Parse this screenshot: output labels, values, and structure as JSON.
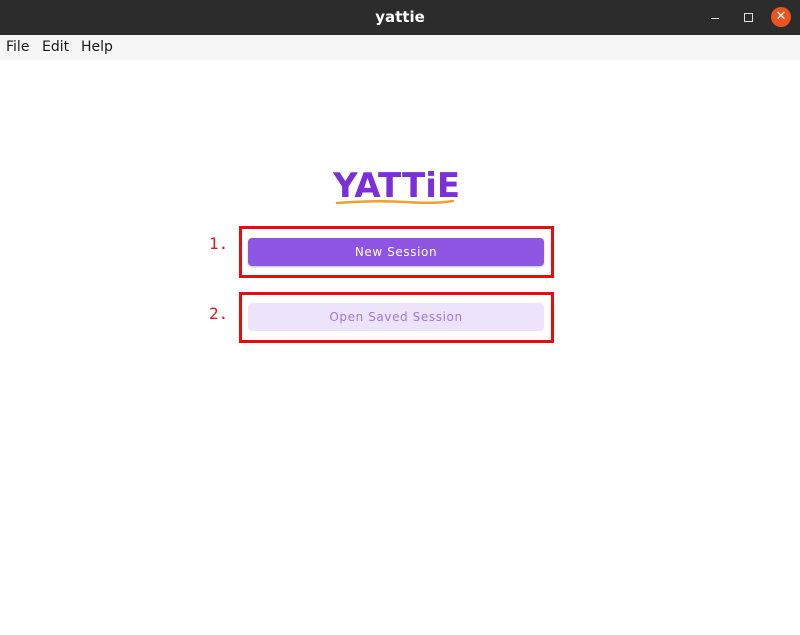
{
  "window": {
    "title": "yattie",
    "controls": {
      "minimize_icon": "minimize-icon",
      "maximize_icon": "maximize-icon",
      "close_glyph": "✕"
    }
  },
  "menubar": {
    "items": [
      {
        "label": "File"
      },
      {
        "label": "Edit"
      },
      {
        "label": "Help"
      }
    ]
  },
  "main": {
    "logo_text": "YATTiE",
    "annotations": [
      "1.",
      "2."
    ],
    "buttons": {
      "new_session": "New Session",
      "open_saved_session": "Open Saved Session"
    }
  },
  "colors": {
    "brand": "#7b2fd9",
    "primary_button": "#8d55e2",
    "secondary_button": "#ede4fb",
    "highlight": "#e30f0f",
    "close_button": "#e95420"
  }
}
